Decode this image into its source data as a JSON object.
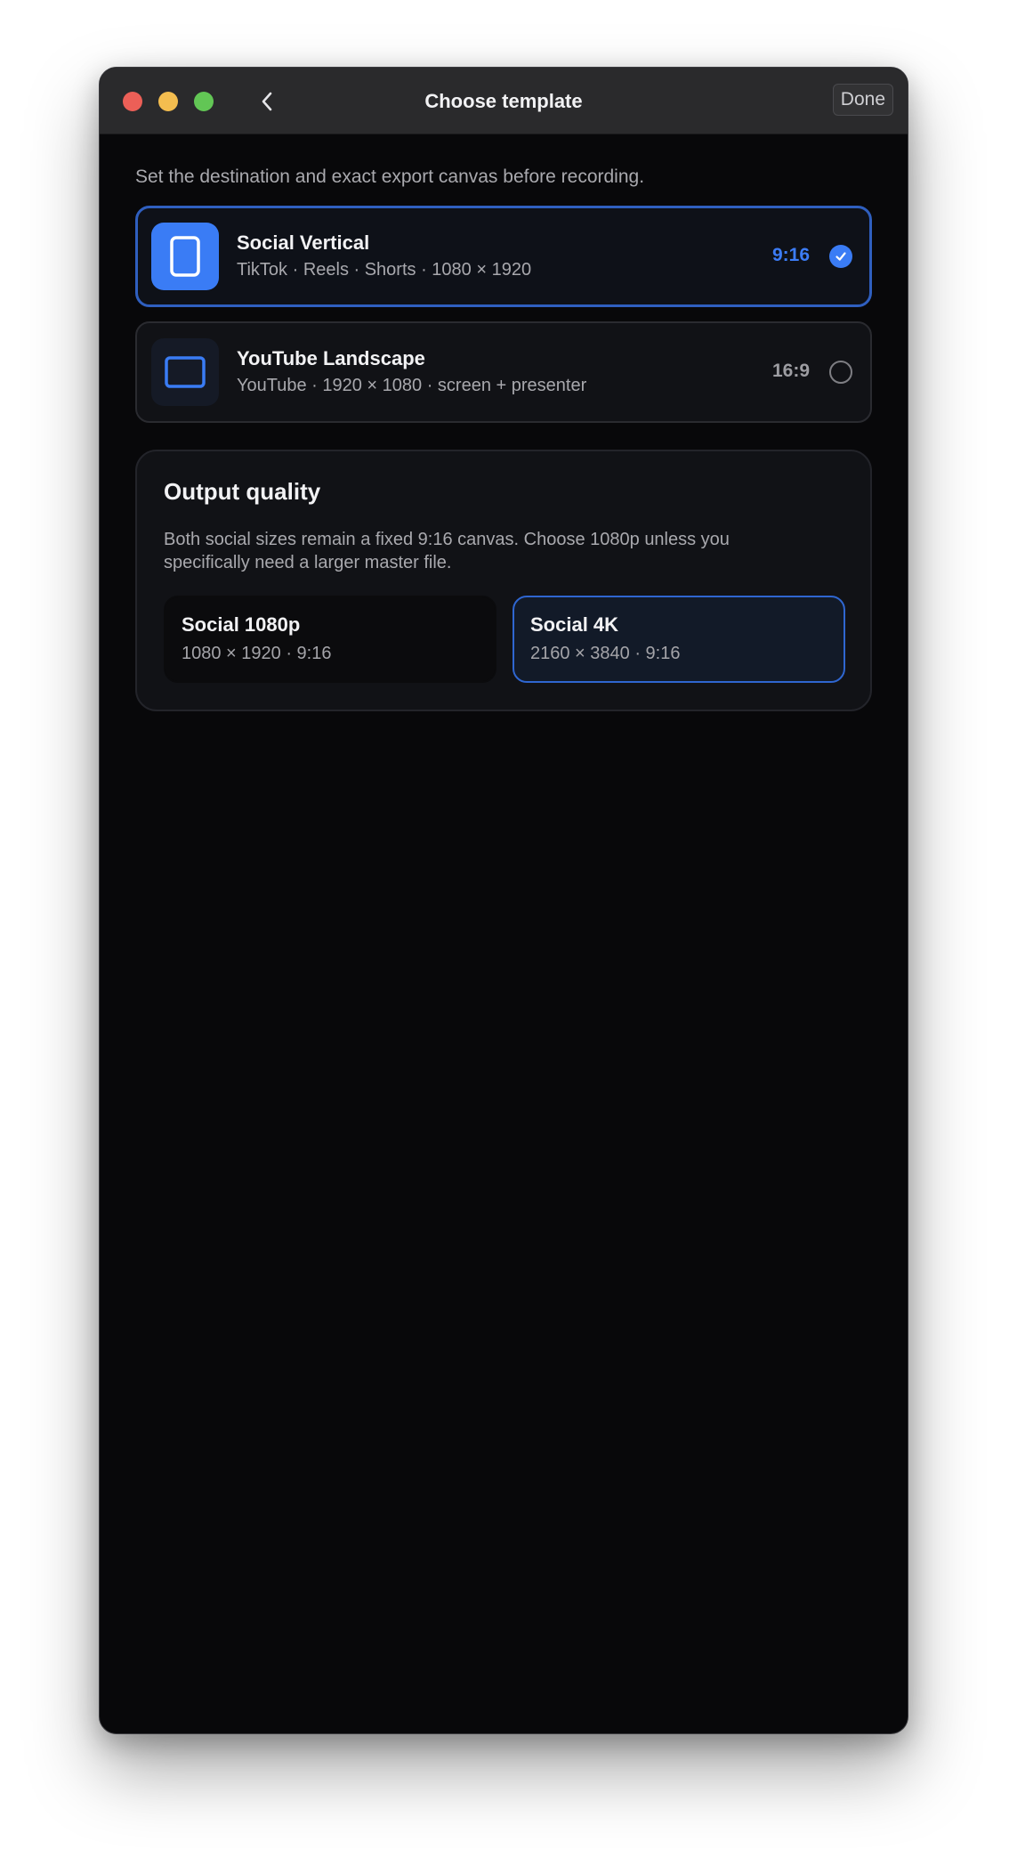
{
  "window": {
    "title": "Choose template",
    "done_label": "Done"
  },
  "intro": "Set the destination and exact export canvas before recording.",
  "templates": [
    {
      "title": "Social Vertical",
      "subtitle": "TikTok · Reels · Shorts · 1080 × 1920",
      "ratio": "9:16",
      "selected": true,
      "icon": "portrait-frame-icon"
    },
    {
      "title": "YouTube Landscape",
      "subtitle": "YouTube · 1920 × 1080 · screen + presenter",
      "ratio": "16:9",
      "selected": false,
      "icon": "landscape-frame-icon"
    }
  ],
  "quality": {
    "title": "Output quality",
    "description": "Both social sizes remain a fixed 9:16 canvas. Choose 1080p unless you specifically need a larger master file.",
    "options": [
      {
        "name": "Social 1080p",
        "spec": "1080 × 1920 · 9:16",
        "selected": false
      },
      {
        "name": "Social 4K",
        "spec": "2160 × 3840 · 9:16",
        "selected": true
      }
    ]
  },
  "colors": {
    "accent": "#3a7cf5",
    "background": "#08080a",
    "card": "#111216",
    "titlebar": "#2a2a2c"
  }
}
